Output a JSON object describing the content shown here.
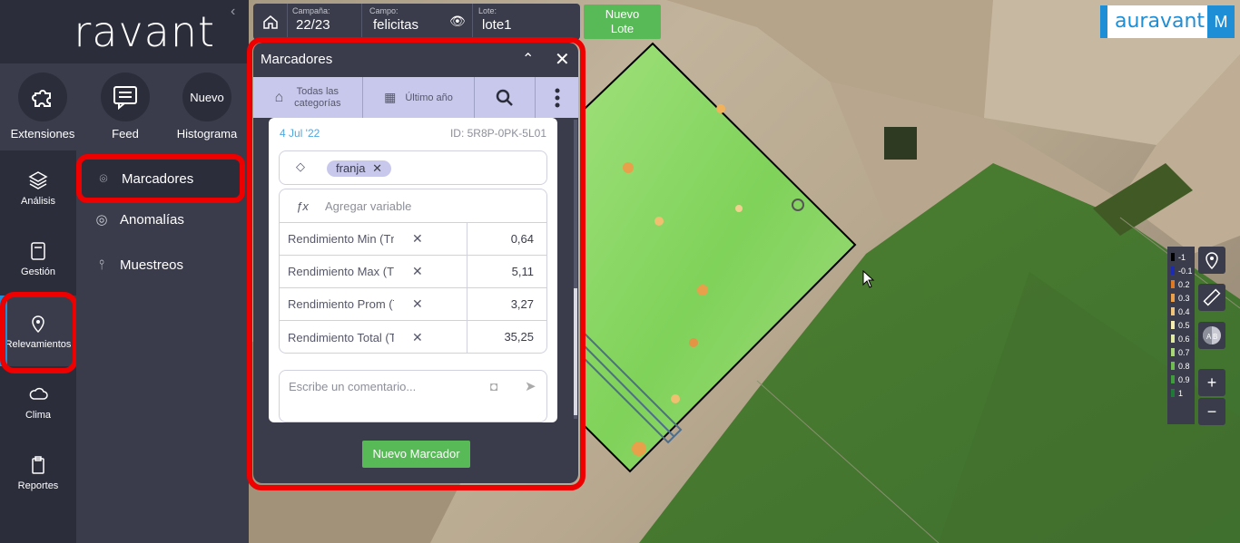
{
  "app": {
    "logo_text": "auravant",
    "collapse_icon": "chevron-left-icon"
  },
  "topnav": [
    {
      "label": "Extensiones",
      "icon": "puzzle-icon"
    },
    {
      "label": "Feed",
      "icon": "message-icon"
    },
    {
      "label": "Histograma",
      "circle_text": "Nuevo"
    }
  ],
  "sidebar": [
    {
      "label": "Análisis",
      "icon": "layers-icon"
    },
    {
      "label": "Gestión",
      "icon": "folder-icon"
    },
    {
      "label": "Relevamientos",
      "icon": "map-pin-icon",
      "active": true
    },
    {
      "label": "Clima",
      "icon": "cloud-icon"
    },
    {
      "label": "Reportes",
      "icon": "clipboard-icon"
    }
  ],
  "submenu": [
    {
      "label": "Marcadores",
      "icon": "map-pin-icon",
      "active": true
    },
    {
      "label": "Anomalías",
      "icon": "target-icon"
    },
    {
      "label": "Muestreos",
      "icon": "probe-icon"
    }
  ],
  "campaign_bar": {
    "campana_label": "Campaña:",
    "campana_value": "22/23",
    "campo_label": "Campo:",
    "campo_value": "felicitas",
    "lote_label": "Lote:",
    "lote_value": "lote1"
  },
  "nuevo_lote": {
    "line1": "Nuevo",
    "line2": "Lote"
  },
  "panel": {
    "title": "Marcadores",
    "filters": {
      "categories_line1": "Todas las",
      "categories_line2": "categorías",
      "period": "Último año"
    },
    "marker": {
      "date": "4 Jul '22",
      "id": "ID: 5R8P-0PK-5L01",
      "tag": "franja",
      "add_variable": "Agregar variable",
      "variables": [
        {
          "name": "Rendimiento Min (Tn/ha)",
          "value": "0,64"
        },
        {
          "name": "Rendimiento Max (Tn/ha)",
          "value": "5,11"
        },
        {
          "name": "Rendimiento Prom (Tn/ha)",
          "value": "3,27"
        },
        {
          "name": "Rendimiento Total (Tn)",
          "value": "35,25"
        }
      ],
      "comment_placeholder": "Escribe un comentario..."
    },
    "new_marker_button": "Nuevo Marcador"
  },
  "brand": {
    "text": "auravant",
    "user_initial": "M"
  },
  "legend": [
    {
      "label": "-1",
      "color": "#000000"
    },
    {
      "label": "-0.1",
      "color": "#1c2bb0"
    },
    {
      "label": "0.2",
      "color": "#e07a22"
    },
    {
      "label": "0.3",
      "color": "#eca04a"
    },
    {
      "label": "0.4",
      "color": "#f0c47a"
    },
    {
      "label": "0.5",
      "color": "#f5ecb0"
    },
    {
      "label": "0.6",
      "color": "#e0eba0"
    },
    {
      "label": "0.7",
      "color": "#a8d878"
    },
    {
      "label": "0.8",
      "color": "#6fbd4f"
    },
    {
      "label": "0.9",
      "color": "#3f9b3c"
    },
    {
      "label": "1",
      "color": "#1e7a36"
    }
  ],
  "zoom": {
    "in": "+",
    "out": "−"
  }
}
